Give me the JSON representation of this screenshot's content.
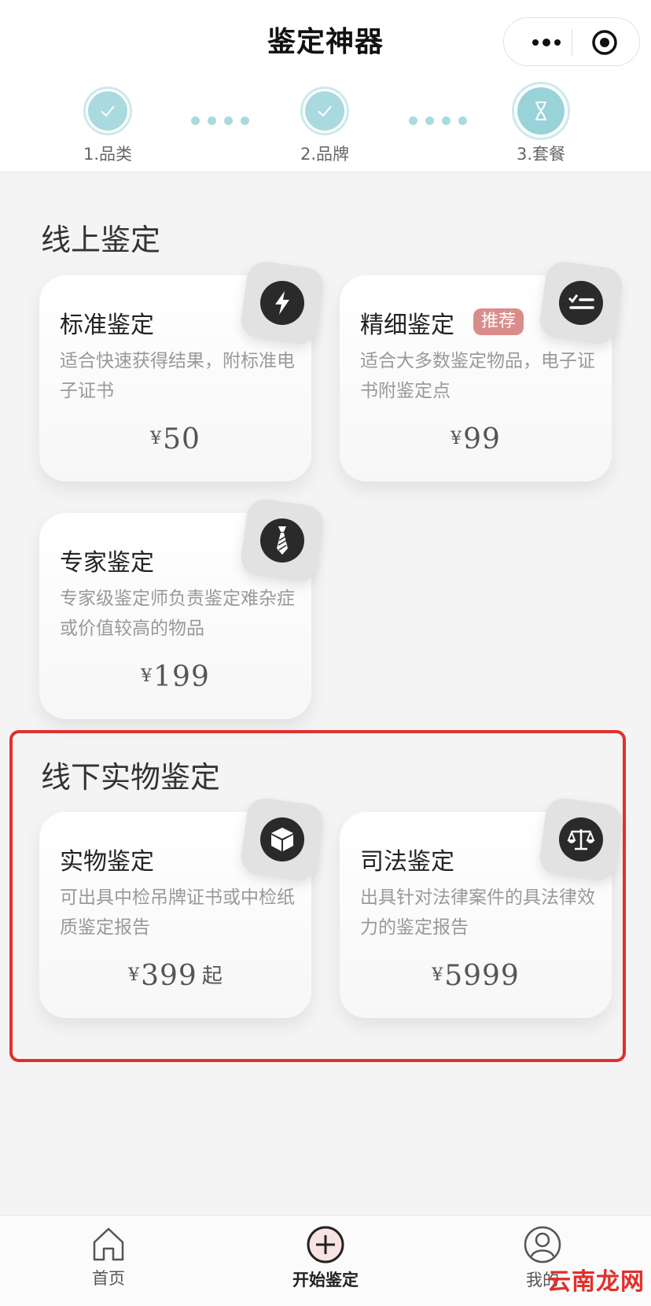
{
  "nav": {
    "title": "鉴定神器"
  },
  "steps": [
    {
      "label": "1.品类"
    },
    {
      "label": "2.品牌"
    },
    {
      "label": "3.套餐"
    }
  ],
  "online": {
    "title": "线上鉴定",
    "cards": [
      {
        "title": "标准鉴定",
        "desc": "适合快速获得结果，附标准电子证书",
        "currency": "¥",
        "price": "50",
        "icon": "lightning-icon"
      },
      {
        "title": "精细鉴定",
        "tag": "推荐",
        "desc": "适合大多数鉴定物品，电子证书附鉴定点",
        "currency": "¥",
        "price": "99",
        "icon": "checklist-icon"
      },
      {
        "title": "专家鉴定",
        "desc": "专家级鉴定师负责鉴定难杂症或价值较高的物品",
        "currency": "¥",
        "price": "199",
        "icon": "necktie-icon"
      }
    ]
  },
  "offline": {
    "title": "线下实物鉴定",
    "cards": [
      {
        "title": "实物鉴定",
        "desc": "可出具中检吊牌证书或中检纸质鉴定报告",
        "currency": "¥",
        "price": "399",
        "suffix": "起",
        "icon": "cube-icon"
      },
      {
        "title": "司法鉴定",
        "desc": "出具针对法律案件的具法律效力的鉴定报告",
        "currency": "¥",
        "price": "5999",
        "icon": "scales-icon"
      }
    ]
  },
  "tabbar": {
    "items": [
      {
        "label": "首页",
        "icon": "home-icon"
      },
      {
        "label": "开始鉴定",
        "icon": "plus-circle-icon"
      },
      {
        "label": "我的",
        "icon": "user-icon"
      }
    ]
  },
  "watermark": "云南龙网",
  "colors": {
    "accent": "#a9dadf",
    "tag": "#d98d8b",
    "highlight_border": "#e0302a"
  }
}
